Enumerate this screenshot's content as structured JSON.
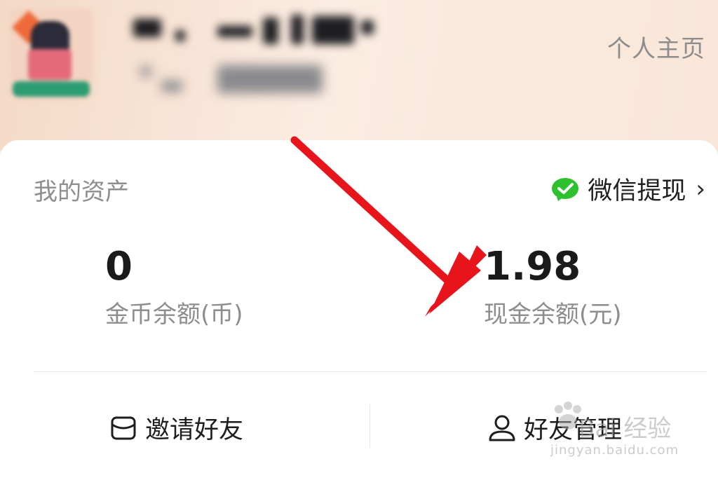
{
  "header": {
    "profile_link": "个人主页"
  },
  "assets": {
    "title": "我的资产",
    "withdraw_label": "微信提现",
    "coin": {
      "value": "0",
      "label": "金币余额(币)"
    },
    "cash": {
      "value": "1.98",
      "label": "现金余额(元)"
    }
  },
  "actions": {
    "invite": "邀请好友",
    "friends": "好友管理"
  },
  "watermark": {
    "main": "Bai 经验",
    "sub": "jingyan.baidu.com"
  },
  "colors": {
    "wechat_green": "#2dc12d",
    "annotation_red": "#e8141c"
  },
  "icons": {
    "withdraw": "wechat-icon",
    "invite": "mail-icon",
    "friends": "person-icon",
    "chevron": "chevron-right-icon"
  }
}
